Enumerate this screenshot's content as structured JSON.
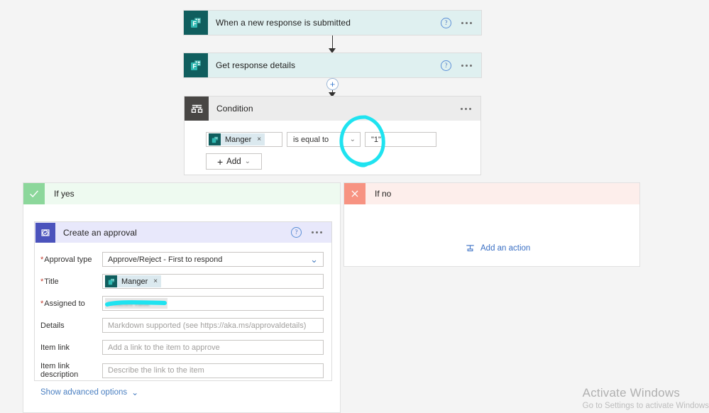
{
  "canvas": {
    "background": "#f4f4f4"
  },
  "trigger": {
    "title": "When a new response is submitted",
    "icon": "microsoft-forms-icon",
    "help_label": "?",
    "menu_label": "…"
  },
  "action_get_response": {
    "title": "Get response details",
    "icon": "microsoft-forms-icon",
    "help_label": "?",
    "menu_label": "…"
  },
  "insert_button": {
    "label": "+"
  },
  "condition": {
    "title": "Condition",
    "icon": "condition-branch-icon",
    "menu_label": "…",
    "row": {
      "token_label": "Manger",
      "token_remove": "×",
      "operator": "is equal to",
      "operator_chevron": "⌄",
      "value": "\"1\""
    },
    "add_button": {
      "plus": "+",
      "label": "Add",
      "chevron": "⌄"
    },
    "annotation": {
      "type": "hand-drawn-circle",
      "color": "#22e0ee",
      "targets": "condition value field"
    }
  },
  "branch_yes": {
    "label": "If yes",
    "icon": "checkmark-icon",
    "header_color": "#8cd79b"
  },
  "branch_no": {
    "label": "If no",
    "icon": "close-x-icon",
    "header_color": "#f79382",
    "add_action": {
      "label": "Add an action",
      "icon": "add-action-icon"
    }
  },
  "approval": {
    "title": "Create an approval",
    "icon": "approval-check-icon",
    "help_label": "?",
    "menu_label": "…",
    "fields": [
      {
        "label": "Approval type",
        "required": true,
        "type": "select",
        "value": "Approve/Reject - First to respond",
        "placeholder": "",
        "chevron": "⌄"
      },
      {
        "label": "Title",
        "required": true,
        "type": "token",
        "value": "Manger",
        "token_remove": "×",
        "placeholder": ""
      },
      {
        "label": "Assigned to",
        "required": true,
        "type": "redacted",
        "value": "",
        "placeholder": "",
        "redacted_text": "redacted value"
      },
      {
        "label": "Details",
        "required": false,
        "type": "text",
        "value": "",
        "placeholder": "Markdown supported (see https://aka.ms/approvaldetails)"
      },
      {
        "label": "Item link",
        "required": false,
        "type": "text",
        "value": "",
        "placeholder": "Add a link to the item to approve"
      },
      {
        "label": "Item link description",
        "required": false,
        "type": "text",
        "value": "",
        "placeholder": "Describe the link to the item"
      }
    ],
    "advanced_options": {
      "label": "Show advanced options",
      "chevron": "⌄"
    }
  },
  "watermark": {
    "line1": "Activate Windows",
    "line2": "Go to Settings to activate Windows"
  }
}
